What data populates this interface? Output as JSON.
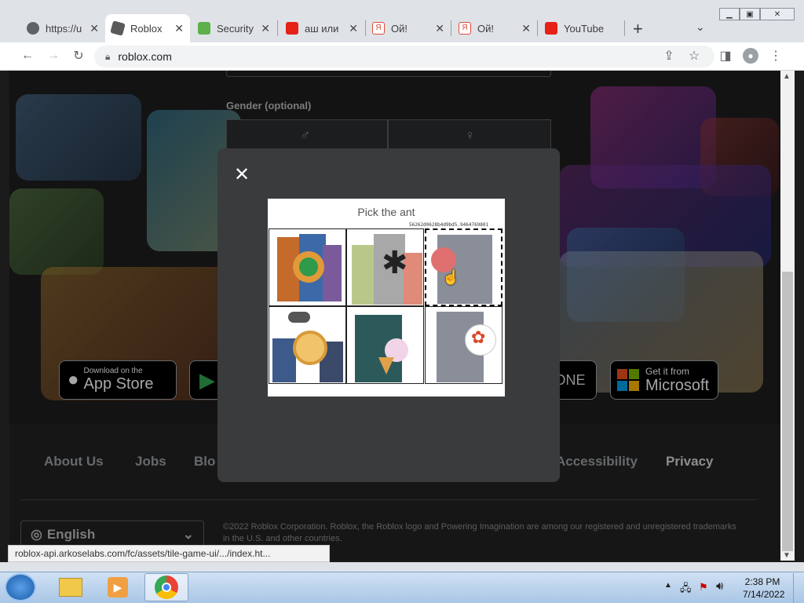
{
  "browser": {
    "tabs": [
      {
        "title": "https://u",
        "color": "#5f6368"
      },
      {
        "title": "Roblox",
        "color": "#5a5a5a"
      },
      {
        "title": "Security",
        "color": "#5db04a"
      },
      {
        "title": "аш или",
        "color": "#e62117"
      },
      {
        "title": "Ой!",
        "color": "#e04a3a"
      },
      {
        "title": "Ой!",
        "color": "#e04a3a"
      },
      {
        "title": "YouTube",
        "color": "#e62117"
      }
    ],
    "new_tab": "+",
    "url": "roblox.com"
  },
  "page": {
    "gender_label": "Gender (optional)",
    "stores": {
      "apple_small": "Download on the",
      "apple_big": "App Store",
      "xbox": "ONE",
      "ms_small": "Get it from",
      "ms_big": "Microsoft"
    },
    "footer_links": [
      "About Us",
      "Jobs",
      "Blo",
      "Accessibility",
      "Privacy"
    ],
    "language": "English",
    "copyright": "©2022 Roblox Corporation. Roblox, the Roblox logo and Powering Imagination are among our registered and unregistered trademarks in the U.S. and other countries."
  },
  "captcha": {
    "close": "✕",
    "prompt": "Pick the ant",
    "session_id": "56262d0628b4d9bd5.9464769801",
    "cells": [
      "building-with-turtle",
      "building-with-ant",
      "building-with-ladybug",
      "buildings-with-pizza",
      "building-with-icecream",
      "building-with-lobster"
    ]
  },
  "status_url": "roblox-api.arkoselabs.com/fc/assets/tile-game-ui/.../index.ht...",
  "taskbar": {
    "time": "2:38 PM",
    "date": "7/14/2022"
  }
}
